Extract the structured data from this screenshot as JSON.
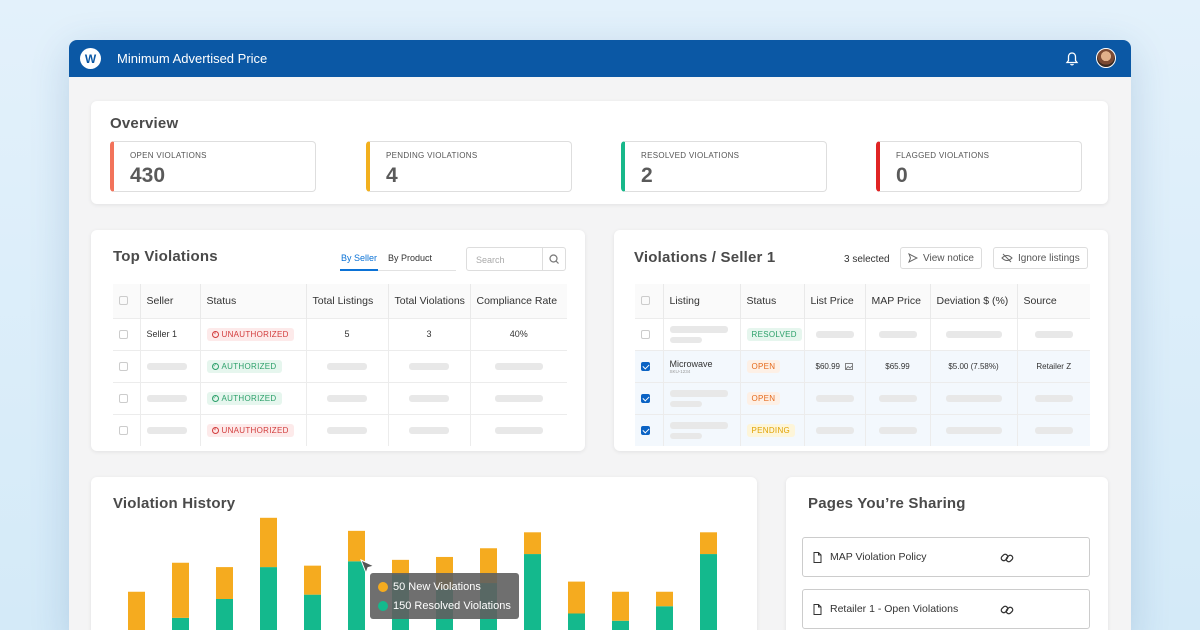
{
  "app": {
    "title": "Minimum Advertised Price",
    "logo_letter": "W"
  },
  "colors": {
    "brand": "#0b58a5",
    "open": "#f2735b",
    "pending": "#f2b01e",
    "resolved": "#17b88a",
    "flagged": "#e02424",
    "new_violations": "#f5ab1f",
    "resolved_violations": "#14b98d"
  },
  "overview": {
    "title": "Overview",
    "stats": [
      {
        "label": "OPEN VIOLATIONS",
        "value": "430"
      },
      {
        "label": "PENDING VIOLATIONS",
        "value": "4"
      },
      {
        "label": "RESOLVED VIOLATIONS",
        "value": "2"
      },
      {
        "label": "FLAGGED VIOLATIONS",
        "value": "0"
      }
    ]
  },
  "top_violations": {
    "title": "Top Violations",
    "tabs": [
      "By Seller",
      "By Product"
    ],
    "search_placeholder": "Search",
    "columns": [
      "Seller",
      "Status",
      "Total Listings",
      "Total Violations",
      "Compliance Rate"
    ],
    "rows": [
      {
        "seller": "Seller 1",
        "status": "UNAUTHORIZED",
        "listings": "5",
        "violations": "3",
        "rate": "40%"
      },
      {
        "status": "AUTHORIZED"
      },
      {
        "status": "AUTHORIZED"
      },
      {
        "status": "UNAUTHORIZED"
      }
    ]
  },
  "seller_violations": {
    "title": "Violations / Seller 1",
    "selected_text": "3 selected",
    "view_notice": "View notice",
    "ignore_listings": "Ignore listings",
    "columns": [
      "Listing",
      "Status",
      "List Price",
      "MAP Price",
      "Deviation $ (%)",
      "Source"
    ],
    "rows": [
      {
        "status": "RESOLVED",
        "checked": false
      },
      {
        "listing": "Microwave",
        "sku": "SKU-1234",
        "status": "OPEN",
        "list_price": "$60.99",
        "map_price": "$65.99",
        "deviation": "$5.00 (7.58%)",
        "source": "Retailer Z",
        "checked": true
      },
      {
        "status": "OPEN",
        "checked": true
      },
      {
        "status": "PENDING",
        "checked": true
      }
    ]
  },
  "history": {
    "title": "Violation History",
    "tooltip": {
      "new": "50 New Violations",
      "resolved": "150 Resolved Violations"
    }
  },
  "chart_data": {
    "type": "bar",
    "stacked": true,
    "series": [
      {
        "name": "Resolved Violations",
        "values": [
          10,
          27,
          40,
          62,
          43,
          66,
          57,
          47,
          51,
          71,
          30,
          25,
          35,
          71
        ]
      },
      {
        "name": "New Violations",
        "values": [
          35,
          38,
          22,
          34,
          20,
          21,
          10,
          22,
          24,
          15,
          22,
          20,
          10,
          15
        ]
      }
    ]
  },
  "sharing": {
    "title": "Pages You’re Sharing",
    "items": [
      "MAP Violation Policy",
      "Retailer 1 - Open Violations"
    ]
  }
}
